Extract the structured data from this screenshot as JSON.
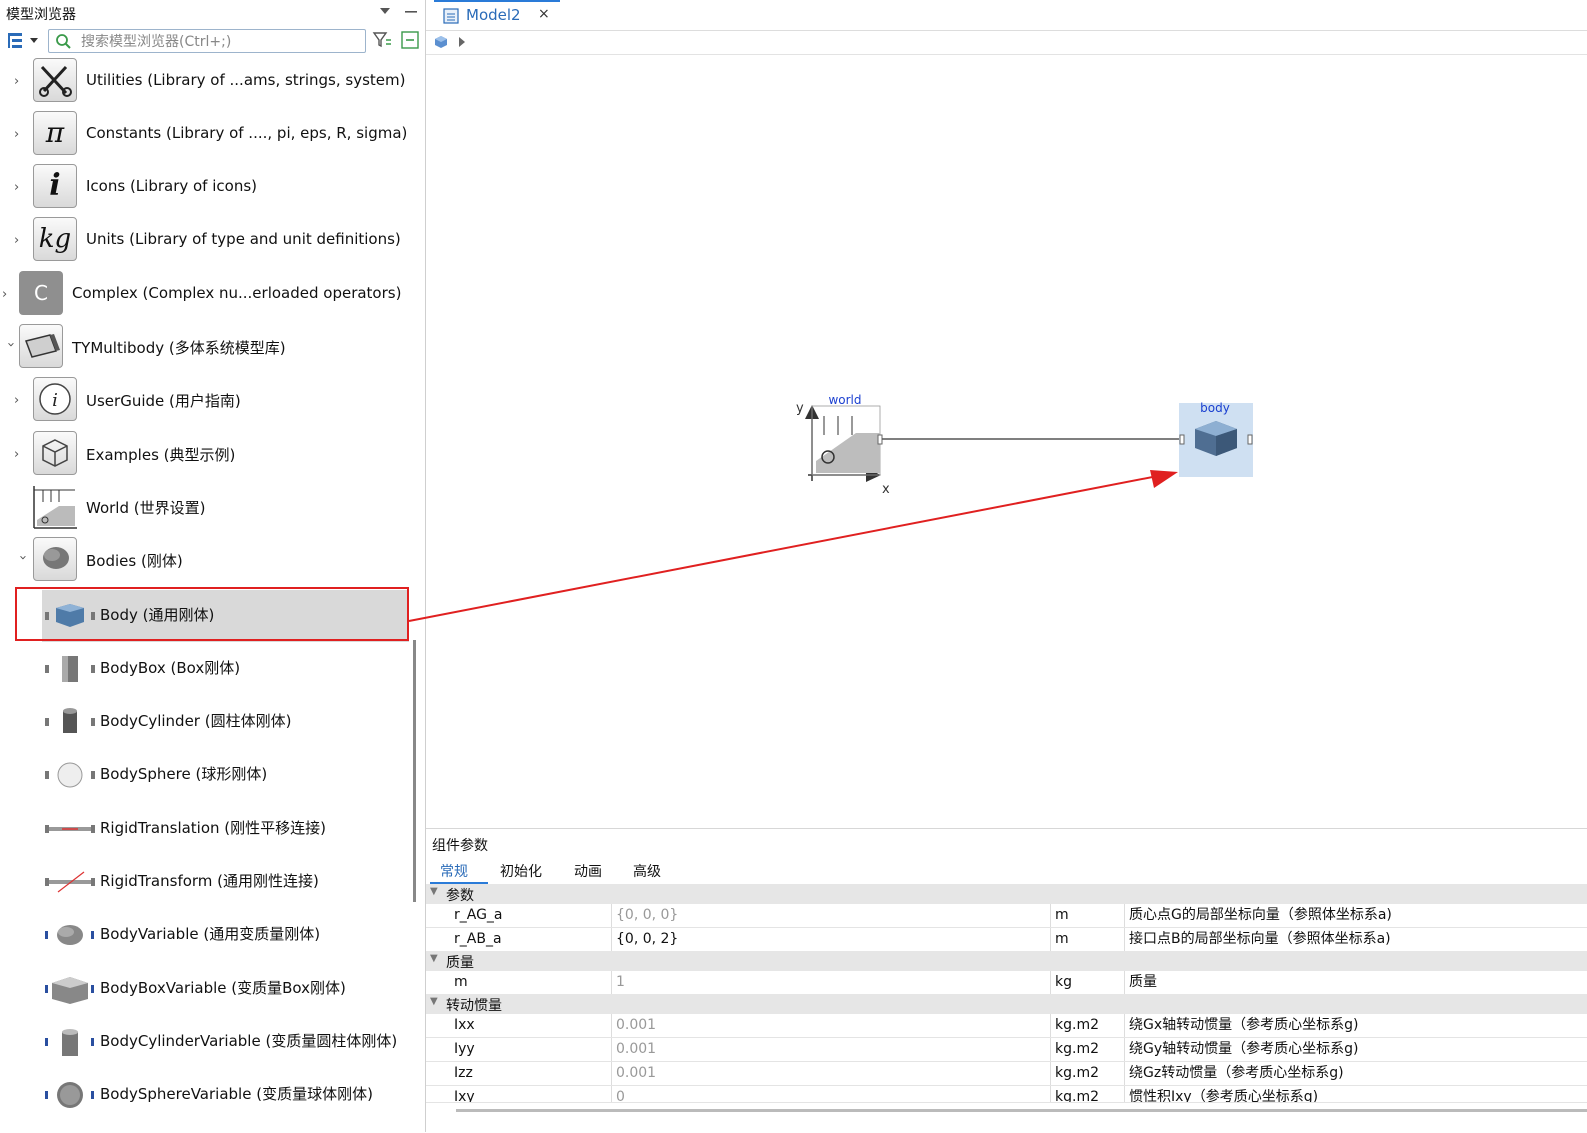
{
  "browser": {
    "title": "模型浏览器",
    "search_placeholder": "搜索模型浏览器(Ctrl+;)",
    "items": [
      {
        "label": "Utilities (Library of ...ams, strings, system)",
        "glyph": "✂"
      },
      {
        "label": "Constants (Library of ...., pi, eps, R, sigma)",
        "glyph": "π"
      },
      {
        "label": "Icons (Library of icons)",
        "glyph": "i"
      },
      {
        "label": "Units (Library of type and unit definitions)",
        "glyph": "kg"
      },
      {
        "label": "Complex (Complex nu...erloaded operators)",
        "glyph": "C"
      },
      {
        "label": "TYMultibody (多体系统模型库)"
      },
      {
        "label": "UserGuide (用户指南)",
        "glyph": "i"
      },
      {
        "label": "Examples (典型示例)"
      },
      {
        "label": "World (世界设置)"
      },
      {
        "label": "Bodies (刚体)"
      },
      {
        "label": "Body (通用刚体)"
      },
      {
        "label": "BodyBox (Box刚体)"
      },
      {
        "label": "BodyCylinder (圆柱体刚体)"
      },
      {
        "label": "BodySphere (球形刚体)"
      },
      {
        "label": "RigidTranslation (刚性平移连接)"
      },
      {
        "label": "RigidTransform (通用刚性连接)"
      },
      {
        "label": "BodyVariable (通用变质量刚体)"
      },
      {
        "label": "BodyBoxVariable (变质量Box刚体)"
      },
      {
        "label": "BodyCylinderVariable (变质量圆柱体刚体)"
      },
      {
        "label": "BodySphereVariable (变质量球体刚体)"
      }
    ]
  },
  "editor": {
    "tab_label": "Model2",
    "tab_close": "×",
    "diagram": {
      "world_label": "world",
      "axis_y": "y",
      "axis_x": "x",
      "body_label": "body"
    }
  },
  "params": {
    "title": "组件参数",
    "tabs": [
      "常规",
      "初始化",
      "动画",
      "高级"
    ],
    "groups": {
      "g1": "参数",
      "g2": "质量",
      "g3": "转动惯量"
    },
    "rows": [
      {
        "name": "r_AG_a",
        "value": "{0, 0, 0}",
        "unit": "m",
        "desc": "质心点G的局部坐标向量（参照体坐标系a)"
      },
      {
        "name": "r_AB_a",
        "value": "{0, 0, 2}",
        "unit": "m",
        "desc": "接口点B的局部坐标向量（参照体坐标系a)"
      },
      {
        "name": "m",
        "value": "1",
        "unit": "kg",
        "desc": "质量"
      },
      {
        "name": "Ixx",
        "value": "0.001",
        "unit": "kg.m2",
        "desc": "绕Gx轴转动惯量（参考质心坐标系g)"
      },
      {
        "name": "Iyy",
        "value": "0.001",
        "unit": "kg.m2",
        "desc": "绕Gy轴转动惯量（参考质心坐标系g)"
      },
      {
        "name": "Izz",
        "value": "0.001",
        "unit": "kg.m2",
        "desc": "绕Gz转动惯量（参考质心坐标系g)"
      },
      {
        "name": "Ixy",
        "value": "0",
        "unit": "kg.m2",
        "desc": "惯性积Ixy（参考质心坐标系g)"
      }
    ]
  },
  "colors": {
    "accent": "#2a7bd8",
    "annotation_red": "#e02020",
    "body_highlight": "#cfe0f2",
    "diagram_label_blue": "#1a3fd0"
  }
}
